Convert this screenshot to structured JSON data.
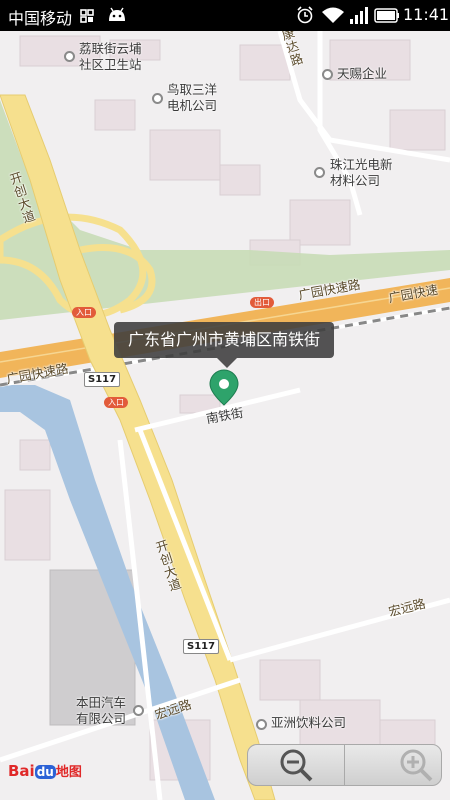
{
  "status_bar": {
    "carrier": "中国移动",
    "time": "11:41"
  },
  "map": {
    "popup_text": "广东省广州市黄埔区南铁街",
    "pin_label": "南铁街",
    "pois": [
      {
        "name": "荔联街云埔\n社区卫生站"
      },
      {
        "name": "鸟取三洋\n电机公司"
      },
      {
        "name": "天赐企业"
      },
      {
        "name": "珠江光电新\n材料公司"
      },
      {
        "name": "本田汽车\n有限公司"
      },
      {
        "name": "亚洲饮料公司"
      }
    ],
    "roads": {
      "guangyuan_1": "广园快速路",
      "guangyuan_2": "广园快速",
      "guangyuan_3": "广园快速路",
      "kaichuang_1": "开创大道",
      "kaichuang_2": "开创大道",
      "hongyuan_1": "宏远路",
      "hongyuan_2": "宏远路",
      "kangda": "康达路",
      "nantie": "南铁街"
    },
    "shields": {
      "s117_a": "S117",
      "s117_b": "S117"
    },
    "tags": {
      "entrance_1": "入口",
      "entrance_2": "入口",
      "exit_1": "出口"
    }
  },
  "branding": {
    "logo_bai": "Bai",
    "logo_du": "du",
    "logo_map": "地图"
  },
  "zoom": {
    "out_icon": "zoom-out-icon",
    "in_icon": "zoom-in-icon"
  }
}
